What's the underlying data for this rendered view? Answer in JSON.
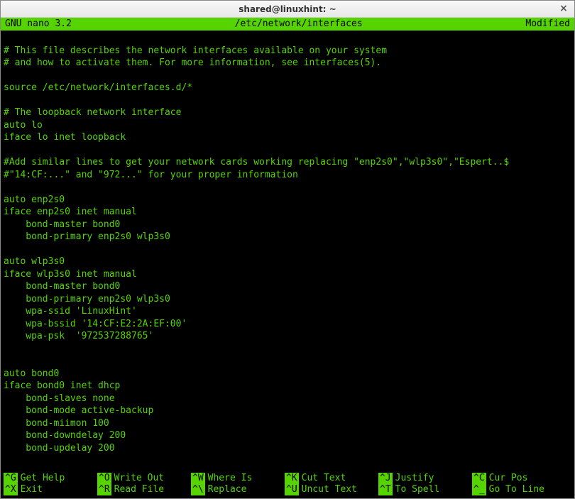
{
  "titlebar": {
    "title": "shared@linuxhint: ~",
    "close_glyph": "×"
  },
  "nano_header": {
    "version": "  GNU nano 3.2",
    "filename": "/etc/network/interfaces",
    "status": "Modified  "
  },
  "editor_text": "\n# This file describes the network interfaces available on your system\n# and how to activate them. For more information, see interfaces(5).\n\nsource /etc/network/interfaces.d/*\n\n# The loopback network interface\nauto lo\niface lo inet loopback\n\n#Add similar lines to get your network cards working replacing \"enp2s0\",\"wlp3s0\",\"Espert..$\n#\"14:CF:...\" and \"972...\" for your proper information\n\nauto enp2s0\niface enp2s0 inet manual\n    bond-master bond0\n    bond-primary enp2s0 wlp3s0\n\nauto wlp3s0\niface wlp3s0 inet manual\n    bond-master bond0\n    bond-primary enp2s0 wlp3s0\n    wpa-ssid 'LinuxHint'\n    wpa-bssid '14:CF:E2:2A:EF:00'\n    wpa-psk  '972537288765'\n\n\nauto bond0\niface bond0 inet dhcp\n    bond-slaves none\n    bond-mode active-backup\n    bond-miimon 100\n    bond-downdelay 200\n    bond-updelay 200",
  "shortcuts": {
    "row1": [
      {
        "key": "^G",
        "label": "Get Help"
      },
      {
        "key": "^O",
        "label": "Write Out"
      },
      {
        "key": "^W",
        "label": "Where Is"
      },
      {
        "key": "^K",
        "label": "Cut Text"
      },
      {
        "key": "^J",
        "label": "Justify"
      },
      {
        "key": "^C",
        "label": "Cur Pos"
      }
    ],
    "row2": [
      {
        "key": "^X",
        "label": "Exit"
      },
      {
        "key": "^R",
        "label": "Read File"
      },
      {
        "key": "^\\",
        "label": "Replace"
      },
      {
        "key": "^U",
        "label": "Uncut Text"
      },
      {
        "key": "^T",
        "label": "To Spell"
      },
      {
        "key": "^_",
        "label": "Go To Line"
      }
    ]
  }
}
